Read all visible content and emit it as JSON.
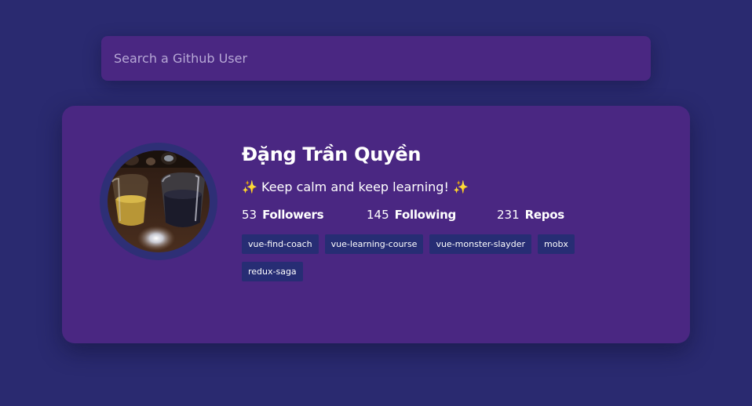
{
  "search": {
    "placeholder": "Search a Github User",
    "value": ""
  },
  "profile": {
    "name": "Đặng Trần Quyền",
    "bio": "✨ Keep calm and keep learning! ✨",
    "stats": [
      {
        "value": "53",
        "label": "Followers"
      },
      {
        "value": "145",
        "label": "Following"
      },
      {
        "value": "231",
        "label": "Repos"
      }
    ],
    "repos": [
      "vue-find-coach",
      "vue-learning-course",
      "vue-monster-slayder",
      "mobx",
      "redux-saga"
    ]
  },
  "colors": {
    "background": "#2a2a70",
    "card": "#4a2782",
    "tag": "#272d74"
  }
}
